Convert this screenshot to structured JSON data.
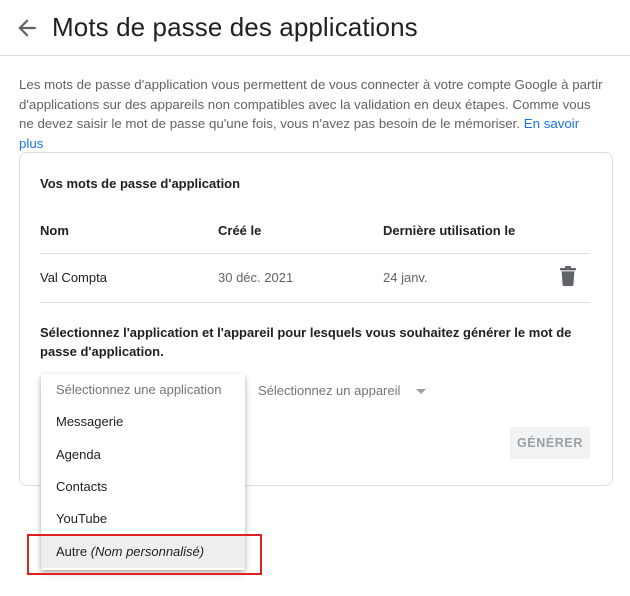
{
  "header": {
    "back_icon": "arrow-left-icon",
    "title": "Mots de passe des applications"
  },
  "intro": {
    "text": "Les mots de passe d'application vous permettent de vous connecter à votre compte Google à partir d'applications sur des appareils non compatibles avec la validation en deux étapes. Comme vous ne devez saisir le mot de passe qu'une fois, vous n'avez pas besoin de le mémoriser.",
    "link_label": "En savoir plus"
  },
  "card": {
    "title": "Vos mots de passe d'application",
    "columns": {
      "name": "Nom",
      "created": "Créé le",
      "last_used": "Dernière utilisation le"
    },
    "rows": [
      {
        "name": "Val Compta",
        "created": "30 déc. 2021",
        "last_used": "24 janv.",
        "delete_icon": "trash-icon"
      }
    ],
    "prompt": "Sélectionnez l'application et l'appareil pour lesquels vous souhaitez générer le mot de passe d'application.",
    "device_select": {
      "placeholder": "Sélectionnez un appareil",
      "caret_icon": "caret-down-icon"
    },
    "generate_label": "GÉNÉRER"
  },
  "app_dropdown": {
    "placeholder": "Sélectionnez une application",
    "options": [
      {
        "label": "Messagerie"
      },
      {
        "label": "Agenda"
      },
      {
        "label": "Contacts"
      },
      {
        "label": "YouTube"
      },
      {
        "label": "Autre",
        "suffix": "(Nom personnalisé)",
        "highlighted": true
      }
    ]
  },
  "colors": {
    "link": "#1a73e8",
    "annotation_border": "#e02020",
    "divider": "#dadce0"
  }
}
